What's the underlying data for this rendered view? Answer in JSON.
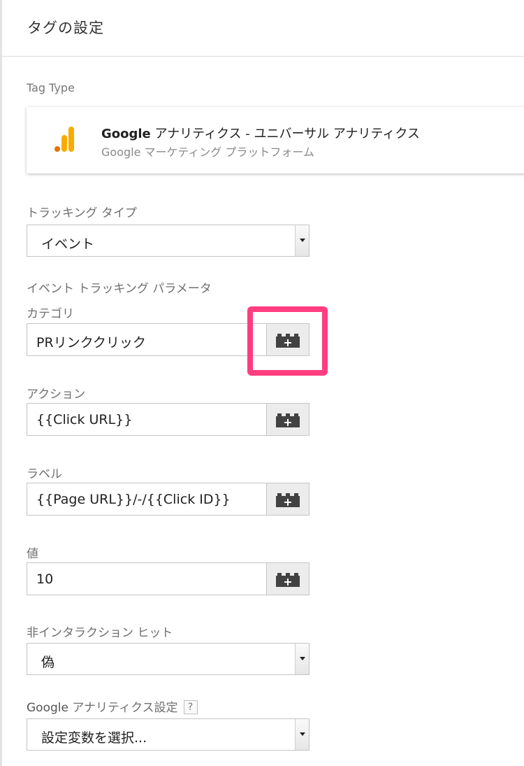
{
  "header": {
    "title": "タグの設定"
  },
  "tag_type": {
    "section_label": "Tag Type",
    "name_bold": "Google",
    "name_rest": " アナリティクス - ユニバーサル アナリティクス",
    "subtitle": "Google マーケティング プラットフォーム",
    "icon": "google-analytics-bars-icon",
    "icon_colors": [
      "#f9ab00",
      "#e37400"
    ]
  },
  "tracking_type": {
    "label": "トラッキング タイプ",
    "selected": "イベント"
  },
  "event_params": {
    "heading": "イベント トラッキング パラメータ",
    "fields": [
      {
        "label": "カテゴリ",
        "value": "PRリンククリック"
      },
      {
        "label": "アクション",
        "value": "{{Click URL}}"
      },
      {
        "label": "ラベル",
        "value": "{{Page URL}}/-/{{Click ID}}"
      },
      {
        "label": "値",
        "value": "10"
      }
    ],
    "variable_button_icon": "variable-lego-plus-icon"
  },
  "non_interaction": {
    "label": "非インタラクション ヒット",
    "selected": "偽"
  },
  "ga_settings": {
    "label_bold": "Google",
    "label_rest": " アナリティクス設定",
    "help": "?",
    "selected": "設定変数を選択..."
  },
  "highlight_color": "#ff3d7f"
}
